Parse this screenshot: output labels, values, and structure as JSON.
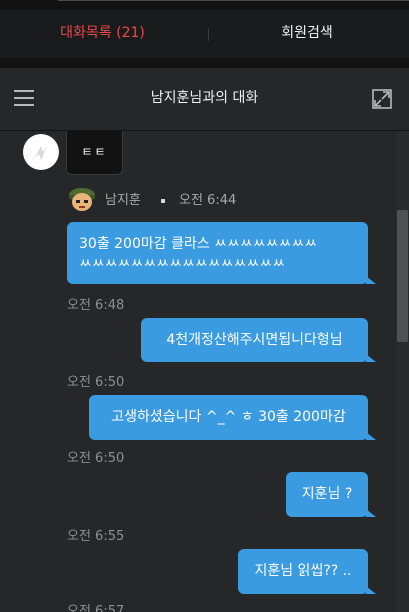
{
  "tabs": [
    {
      "label": "대화목록 (21)",
      "active": true
    },
    {
      "label": "회원검색",
      "active": false
    }
  ],
  "header": {
    "title": "남지훈님과의 대화"
  },
  "chat": {
    "system_bubble_text": "ㅌㅌ",
    "sender": {
      "name": "남지훈",
      "time": "오전 6:44"
    },
    "messages": [
      {
        "text_line1": "30출 200마감 클라스 ㅆㅆㅆㅆㅆㅆㅆㅆ",
        "text_line2": "ㅆㅆㅆㅆㅆㅆㅆㅆㅆㅆㅆㅆㅆㅆㅆㅆ",
        "time": "오전 6:48"
      },
      {
        "text": "4천개정산해주시면됩니다형님",
        "time": "오전 6:50"
      },
      {
        "text": "고생하셨습니다 ^_^ ㅎ 30출 200마감",
        "time": "오전 6:50"
      },
      {
        "text": "지훈님 ?",
        "time": "오전 6:55"
      },
      {
        "text": "지훈님 읽씹?? ..",
        "time": "오전 6:57"
      }
    ]
  },
  "colors": {
    "accent_tab": "#e84a4a",
    "bubble": "#3a9be0",
    "background": "#262729"
  }
}
